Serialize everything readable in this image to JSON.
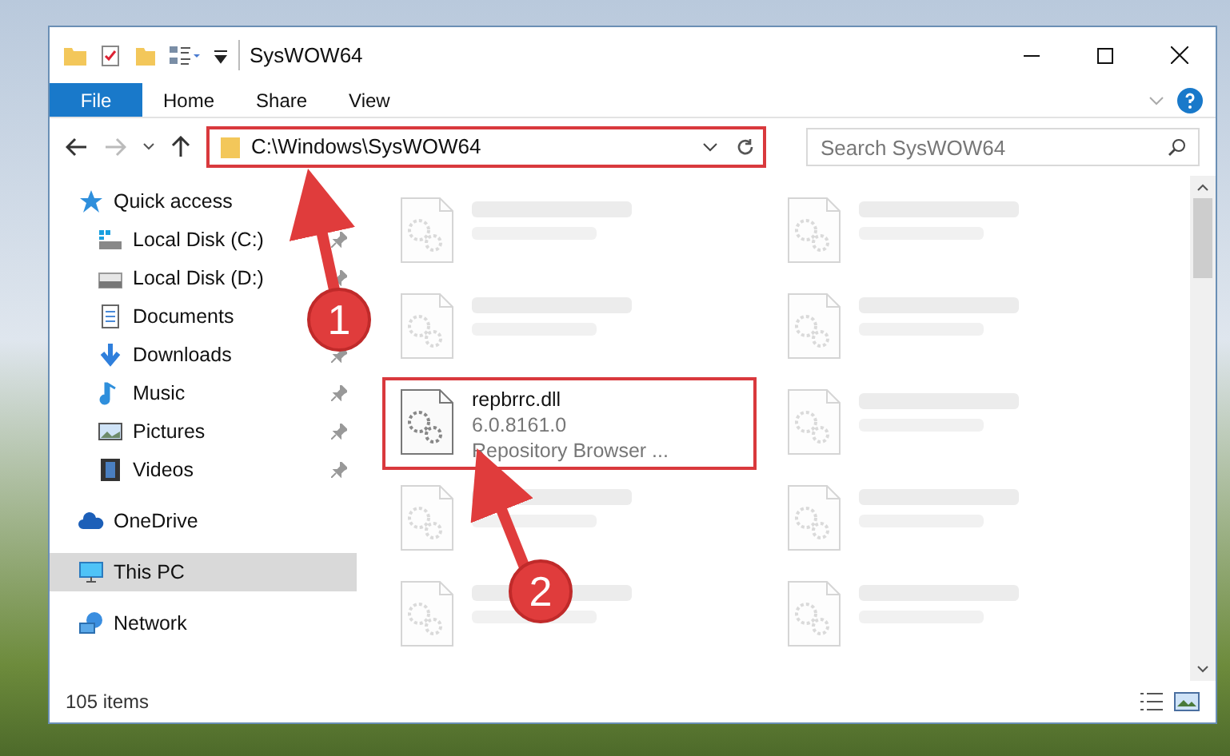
{
  "window": {
    "title": "SysWOW64"
  },
  "ribbon_tabs": [
    {
      "label": "File",
      "kind": "file"
    },
    {
      "label": "Home",
      "kind": "tab"
    },
    {
      "label": "Share",
      "kind": "tab"
    },
    {
      "label": "View",
      "kind": "tab"
    }
  ],
  "address_bar": {
    "path": "C:\\Windows\\SysWOW64",
    "highlighted": true
  },
  "search": {
    "placeholder": "Search SysWOW64"
  },
  "sidebar": {
    "items": [
      {
        "label": "Quick access",
        "selected": false,
        "children": [
          {
            "label": "Local Disk (C:)",
            "pinned": true
          },
          {
            "label": "Local Disk (D:)",
            "pinned": true
          },
          {
            "label": "Documents",
            "pinned": false
          },
          {
            "label": "Downloads",
            "pinned": true
          },
          {
            "label": "Music",
            "pinned": true
          },
          {
            "label": "Pictures",
            "pinned": true
          },
          {
            "label": "Videos",
            "pinned": true
          }
        ]
      },
      {
        "label": "OneDrive",
        "selected": false
      },
      {
        "label": "This PC",
        "selected": true
      },
      {
        "label": "Network",
        "selected": false
      }
    ]
  },
  "files": [
    {
      "kind": "blurred"
    },
    {
      "kind": "blurred"
    },
    {
      "kind": "blurred"
    },
    {
      "kind": "blurred"
    },
    {
      "kind": "file",
      "name": "repbrrc.dll",
      "detail_1": "6.0.8161.0",
      "detail_2": "Repository Browser ...",
      "highlighted": true
    },
    {
      "kind": "blurred"
    },
    {
      "kind": "blurred"
    },
    {
      "kind": "blurred"
    },
    {
      "kind": "blurred"
    },
    {
      "kind": "blurred"
    }
  ],
  "status_bar": {
    "item_count": "105 items"
  },
  "annotations": [
    {
      "number": "1"
    },
    {
      "number": "2"
    }
  ]
}
